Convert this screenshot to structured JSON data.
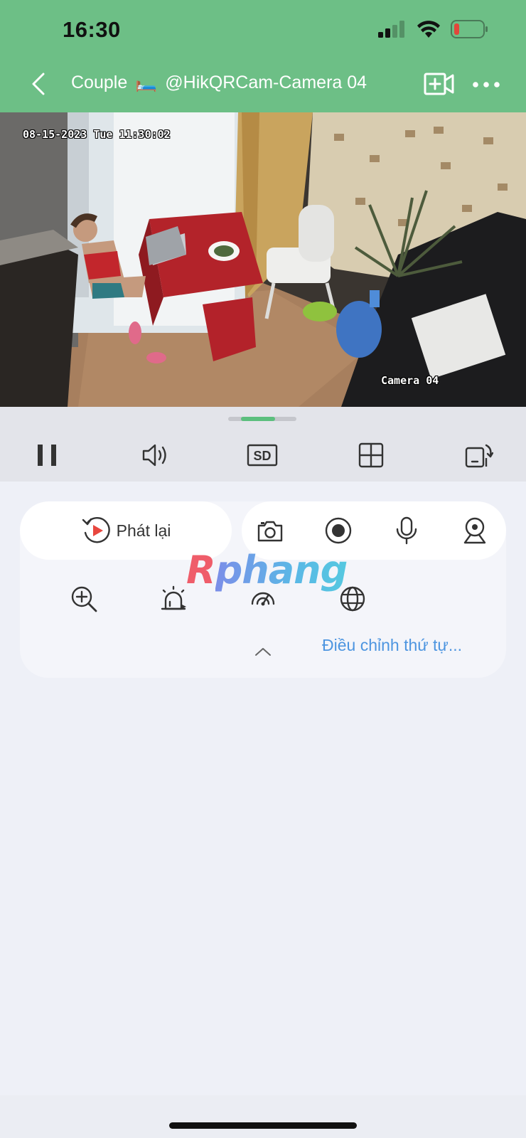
{
  "status_bar": {
    "time": "16:30",
    "icons": [
      "cellular-signal-icon",
      "wifi-icon",
      "battery-low-icon"
    ],
    "battery_color": "#e2473b"
  },
  "nav": {
    "title_prefix": "Couple",
    "title_emoji": "🛏️",
    "title_suffix": "@HikQRCam-Camera 04",
    "back_icon": "chevron-left-icon",
    "add_camera_icon": "add-camera-icon",
    "more_icon": "more-horizontal-icon"
  },
  "video": {
    "osd_timestamp": "08-15-2023 Tue 11:30:02",
    "osd_camera_name": "Camera 04"
  },
  "control_bar": {
    "buttons": [
      {
        "name": "pause-icon"
      },
      {
        "name": "volume-icon"
      },
      {
        "name": "sd-quality-icon",
        "label": "SD"
      },
      {
        "name": "multi-view-grid-icon"
      },
      {
        "name": "rotate-screen-icon"
      }
    ],
    "progress_fraction": 0.5
  },
  "panel": {
    "playback_label": "Phát lại",
    "tools_row1": [
      "camera-snapshot-icon",
      "record-icon",
      "microphone-icon",
      "ptz-icon"
    ],
    "tools_row2": [
      "zoom-in-icon",
      "alarm-icon",
      "speed-gauge-icon",
      "globe-icon"
    ],
    "watermark": {
      "first": "R",
      "rest": "phang"
    },
    "adjust_order_label": "Điều chỉnh thứ tự..."
  },
  "colors": {
    "header": "#6dbf86",
    "accent_link": "#4d95e0",
    "background": "#eef0f7"
  }
}
